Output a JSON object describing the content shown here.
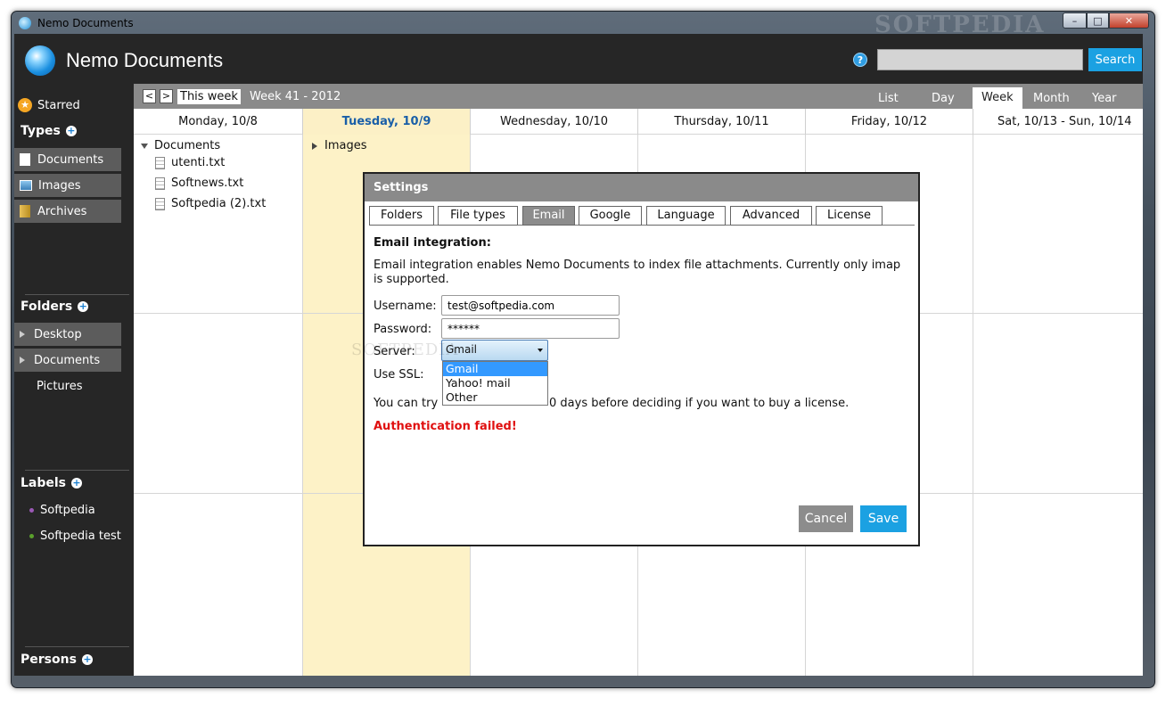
{
  "window": {
    "title": "Nemo Documents",
    "watermark": "SOFTPEDIA",
    "controls": {
      "minimize": "–",
      "maximize": "□",
      "close": "✕"
    }
  },
  "header": {
    "app_name": "Nemo Documents",
    "help_glyph": "?",
    "search_placeholder": "",
    "search_button": "Search"
  },
  "sidebar": {
    "starred": "Starred",
    "types_title": "Types",
    "types": [
      "Documents",
      "Images",
      "Archives"
    ],
    "folders_title": "Folders",
    "folders": [
      "Desktop",
      "Documents",
      "Pictures"
    ],
    "labels_title": "Labels",
    "labels": [
      {
        "name": "Softpedia",
        "color": "#9b59b6"
      },
      {
        "name": "Softpedia test",
        "color": "#5aa02c"
      }
    ],
    "persons_title": "Persons"
  },
  "calendar": {
    "prev": "<",
    "next": ">",
    "this_week": "This week",
    "week_label": "Week 41 - 2012",
    "views": [
      "List",
      "Day",
      "Week",
      "Month",
      "Year"
    ],
    "active_view": "Week",
    "days": [
      "Monday, 10/8",
      "Tuesday, 10/9",
      "Wednesday, 10/10",
      "Thursday, 10/11",
      "Friday, 10/12",
      "Sat, 10/13 - Sun, 10/14"
    ],
    "today_index": 1,
    "monday": {
      "group": "Documents",
      "files": [
        "utenti.txt",
        "Softnews.txt",
        "Softpedia (2).txt"
      ]
    },
    "tuesday": {
      "group": "Images"
    }
  },
  "dialog": {
    "title": "Settings",
    "tabs": [
      "Folders",
      "File types",
      "Email",
      "Google",
      "Language",
      "Advanced",
      "License"
    ],
    "active_tab": "Email",
    "heading": "Email integration:",
    "description": "Email integration enables Nemo Documents to index file attachments. Currently only imap is supported.",
    "username_label": "Username:",
    "username_value": "test@softpedia.com",
    "password_label": "Password:",
    "password_value": "******",
    "server_label": "Server:",
    "server_value": "Gmail",
    "server_options": [
      "Gmail",
      "Yahoo! mail",
      "Other"
    ],
    "ssl_label": "Use SSL:",
    "trial_text_left": "You can try",
    "trial_text_right": "0 days before deciding if you want to buy a license.",
    "error": "Authentication failed!",
    "watermark": "SOFTPEDIA",
    "cancel": "Cancel",
    "save": "Save"
  }
}
